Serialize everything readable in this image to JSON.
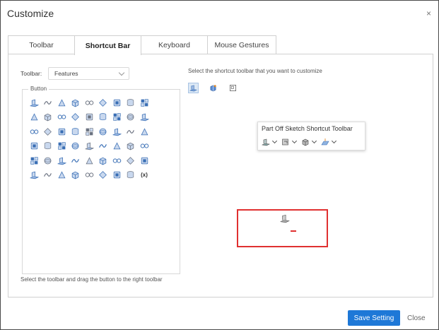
{
  "dialog": {
    "title": "Customize",
    "close_glyph": "×"
  },
  "tabs": [
    {
      "label": "Toolbar",
      "active": false
    },
    {
      "label": "Shortcut Bar",
      "active": true
    },
    {
      "label": "Keyboard",
      "active": false
    },
    {
      "label": "Mouse Gestures",
      "active": false
    }
  ],
  "left": {
    "toolbar_label": "Toolbar:",
    "toolbar_value": "Features",
    "group_legend": "Button",
    "hint": "Select the toolbar and drag the button to the right toolbar"
  },
  "right": {
    "hint": "Select the shortcut toolbar that you want to customize",
    "popup_title": "Part Off Sketch Shortcut Toolbar",
    "shortcut_choices": [
      "part-shortcut-icon",
      "assembly-shortcut-icon",
      "drawing-shortcut-icon"
    ],
    "popup_icons": [
      "extrude-icon",
      "sketch-icon",
      "part-icon",
      "plane-icon"
    ]
  },
  "colors": {
    "accent": "#1e78d7",
    "highlight": "#e03030",
    "icon_blue": "#3a6fb5",
    "icon_grey": "#6b7280"
  },
  "buttons": {
    "save": "Save Setting",
    "close": "Close"
  },
  "grid_icons": [
    "extrude-icon",
    "revolve-icon",
    "sweep-icon",
    "loft-icon",
    "cut-extrude-icon",
    "boss-icon",
    "shell-icon",
    "rib-icon",
    "draft-icon",
    "hole-icon",
    "thread-icon",
    "pattern-icon",
    "mirror-icon",
    "chamfer-icon",
    "fillet-icon",
    "combine-icon",
    "split-icon",
    "cube-icon",
    "solid-icon",
    "face-icon",
    "sphere-icon",
    "box-icon",
    "grid-icon",
    "linear-pattern-icon",
    "circular-pattern-icon",
    "feature-icon",
    "body-icon",
    "wrap-icon",
    "dome-icon",
    "cylinder-icon",
    "block-icon",
    "rotate-icon",
    "surface-icon",
    "flat-icon",
    "cone-icon",
    "ball-icon",
    "wedge-icon",
    "pyramid-icon",
    "torus-icon",
    "ellipse-icon",
    "plane-icon",
    "prism-icon",
    "point-icon",
    "axis-icon",
    "coordinate-icon",
    "curve-icon",
    "sketch-plane-icon",
    "helix-icon",
    "thread-cosmetic-icon",
    "spline-icon",
    "layers-icon",
    "tag-icon",
    "stamp-icon",
    "variable-icon"
  ],
  "grid_last_label": "(x)"
}
